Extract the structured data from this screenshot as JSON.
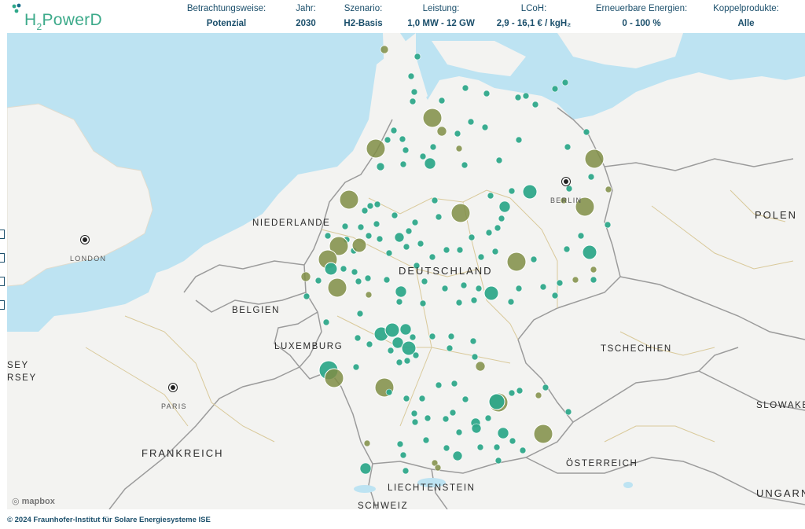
{
  "app": {
    "logo_text": "H",
    "logo_sub": "2",
    "logo_rest": "PowerD"
  },
  "filters": [
    {
      "label": "Betrachtungsweise:",
      "value": "Potenzial"
    },
    {
      "label": "Jahr:",
      "value": "2030"
    },
    {
      "label": "Szenario:",
      "value": "H2-Basis"
    },
    {
      "label": "Leistung:",
      "value": "1,0 MW - 12 GW"
    },
    {
      "label": "LCoH:",
      "value": "2,9 - 16,1 € / kgH₂"
    },
    {
      "label": "Erneuerbare Energien:",
      "value": "0 - 100 %"
    },
    {
      "label": "Koppelprodukte:",
      "value": "Alle"
    }
  ],
  "map": {
    "countries": {
      "de": "DEUTSCHLAND",
      "nl": "NIEDERLANDE",
      "be": "BELGIEN",
      "lu": "LUXEMBURG",
      "fr": "FRANKREICH",
      "ch": "SCHWEIZ",
      "li": "LIECHTENSTEIN",
      "at": "ÖSTERREICH",
      "cz": "TSCHECHIEN",
      "pl": "POLEN",
      "sk": "SLOWAKE",
      "hu": "UNGARN",
      "je1": "SEY",
      "je2": "RSEY"
    },
    "cities": {
      "london": "LONDON",
      "paris": "PARIS",
      "berlin": "BERLIN"
    },
    "attribution": "mapbox",
    "colors": {
      "water": "#bde3f2",
      "land": "#f3f3f1",
      "teal": "#2fa88a",
      "olive": "#7f8d45"
    }
  },
  "footer": {
    "copyright": "© 2024 Fraunhofer-Institut für Solare Energiesysteme ISE"
  }
}
